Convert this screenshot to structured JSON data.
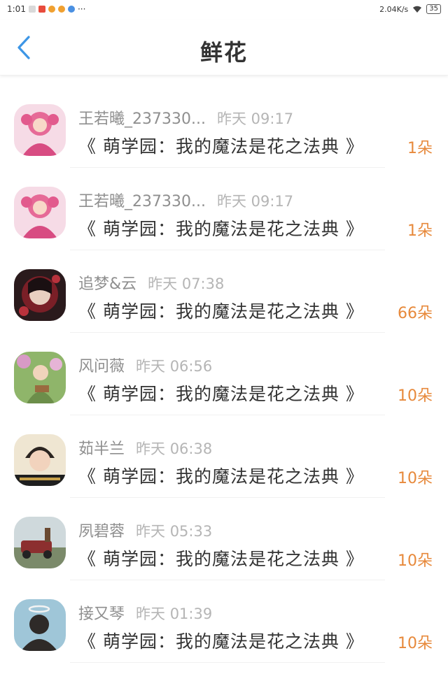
{
  "status_bar": {
    "time": "1:01",
    "more": "···",
    "net_speed": "2.04K/s",
    "battery": "35"
  },
  "nav": {
    "title": "鲜花"
  },
  "rows": [
    {
      "name": "王若曦_237330...",
      "time": "昨天 09:17",
      "book": "《 萌学园：我的魔法是花之法典 》",
      "count": "1朵"
    },
    {
      "name": "王若曦_237330...",
      "time": "昨天 09:17",
      "book": "《 萌学园：我的魔法是花之法典 》",
      "count": "1朵"
    },
    {
      "name": "追梦&云",
      "time": "昨天 07:38",
      "book": "《 萌学园：我的魔法是花之法典 》",
      "count": "66朵"
    },
    {
      "name": "风问薇",
      "time": "昨天 06:56",
      "book": "《 萌学园：我的魔法是花之法典 》",
      "count": "10朵"
    },
    {
      "name": "茹半兰",
      "time": "昨天 06:38",
      "book": "《 萌学园：我的魔法是花之法典 》",
      "count": "10朵"
    },
    {
      "name": "夙碧蓉",
      "time": "昨天 05:33",
      "book": "《 萌学园：我的魔法是花之法典 》",
      "count": "10朵"
    },
    {
      "name": "接又琴",
      "time": "昨天 01:39",
      "book": "《 萌学园：我的魔法是花之法典 》",
      "count": "10朵"
    }
  ],
  "colors": {
    "accent_back": "#3d96e6",
    "count": "#e7893b"
  }
}
